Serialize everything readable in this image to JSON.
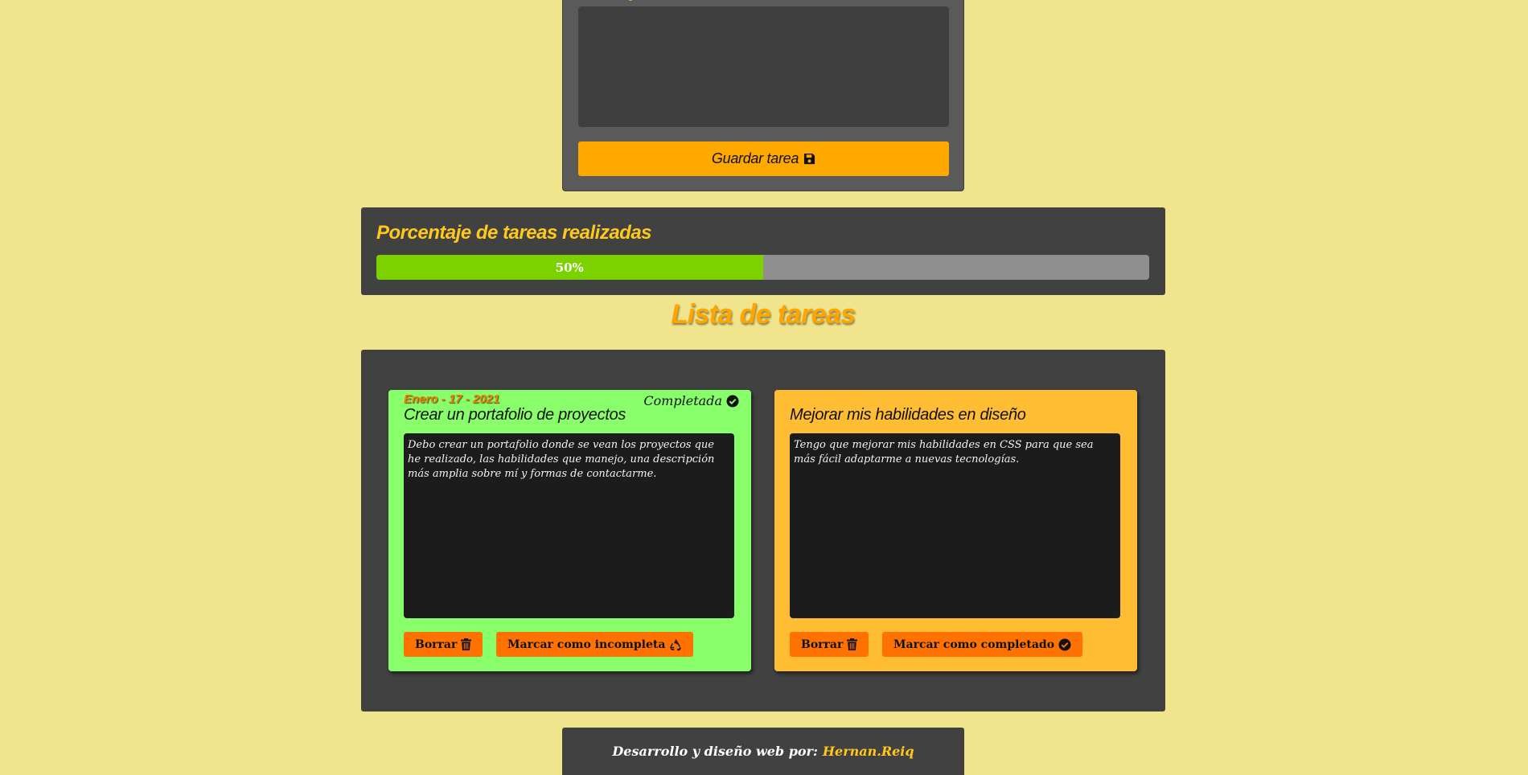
{
  "form": {
    "save_label": "Guardar tarea"
  },
  "progress": {
    "title": "Porcentaje de tareas realizadas",
    "percent": 50,
    "text": "50%",
    "fill_color": "#7cd100"
  },
  "list": {
    "heading": "Lista de tareas",
    "tasks": [
      {
        "date": "Enero - 17 - 2021",
        "status": "Completada",
        "title": "Crear un portafolio de proyectos",
        "description": "Debo crear un portafolio donde se vean los proyectos que he realizado, las habilidades que manejo, una descripción más amplia sobre mí y formas de contactarme.",
        "delete_label": "Borrar",
        "toggle_label": "Marcar como incompleta",
        "card_color": "#87fe6a"
      },
      {
        "title": "Mejorar mis habilidades en diseño",
        "description": "Tengo que mejorar mis habilidades en CSS para que sea más fácil adaptarme a nuevas tecnologías.",
        "delete_label": "Borrar",
        "toggle_label": "Marcar como completado",
        "card_color": "#ffbd33"
      }
    ]
  },
  "footer": {
    "credit": "Desarrollo y diseño web por:",
    "author": "Hernan.Reiq"
  },
  "icons": {
    "save": "floppy-disk-icon",
    "done": "check-circle-icon",
    "delete": "trash-icon",
    "undo": "recycle-icon"
  }
}
